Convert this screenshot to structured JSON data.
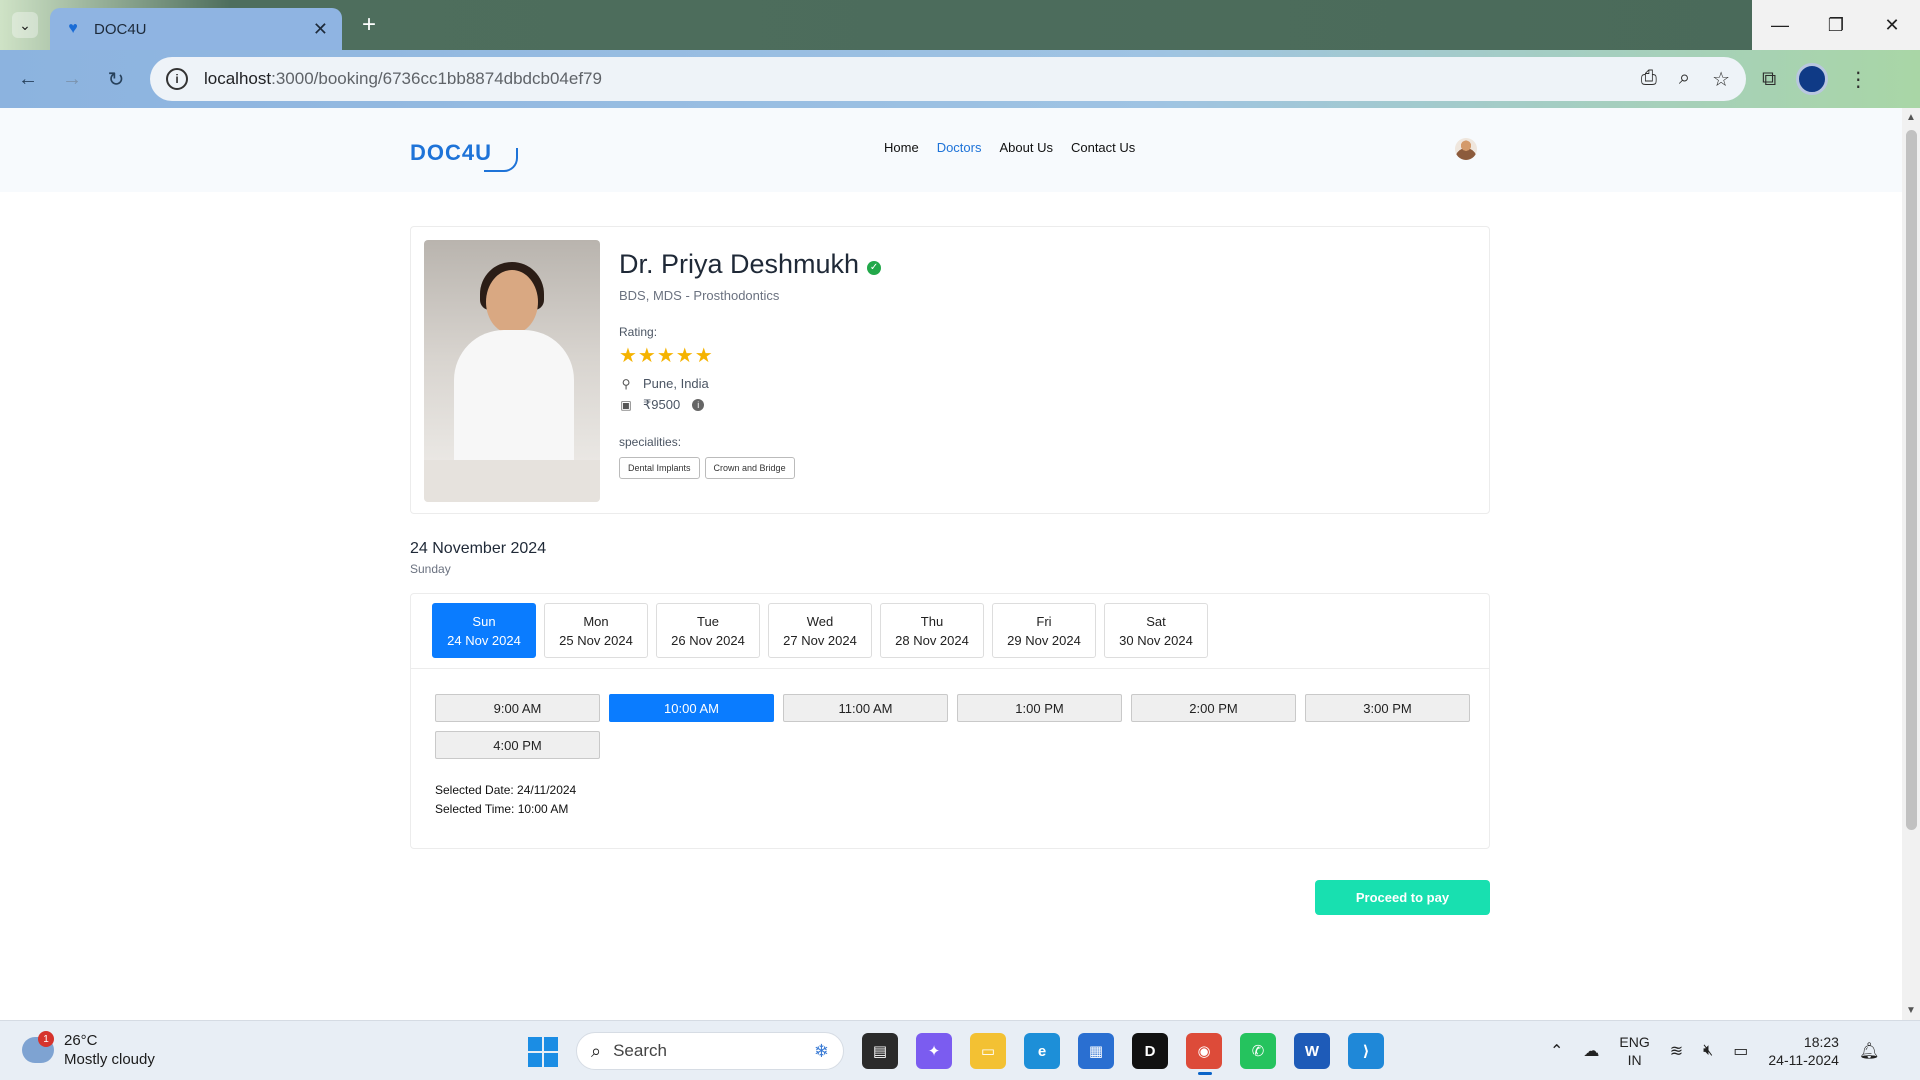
{
  "browser": {
    "tab_title": "DOC4U",
    "url_host": "localhost",
    "url_path": ":3000/booking/6736cc1bb8874dbdcb04ef79"
  },
  "navbar": {
    "logo": "DOC4U",
    "links": [
      "Home",
      "Doctors",
      "About Us",
      "Contact Us"
    ],
    "active_link": "Doctors"
  },
  "doctor": {
    "name": "Dr. Priya Deshmukh",
    "degree": "BDS, MDS - Prosthodontics",
    "rating_label": "Rating:",
    "rating": 5,
    "rating_max": 5,
    "stars": "★★★★★",
    "location": "Pune, India",
    "fee": "₹9500",
    "specialities_label": "specialities:",
    "specialities": [
      "Dental Implants",
      "Crown and Bridge"
    ]
  },
  "booking": {
    "date_title": "24 November 2024",
    "day_sub": "Sunday",
    "days": [
      {
        "day": "Sun",
        "date": "24 Nov 2024",
        "selected": true
      },
      {
        "day": "Mon",
        "date": "25 Nov 2024",
        "selected": false
      },
      {
        "day": "Tue",
        "date": "26 Nov 2024",
        "selected": false
      },
      {
        "day": "Wed",
        "date": "27 Nov 2024",
        "selected": false
      },
      {
        "day": "Thu",
        "date": "28 Nov 2024",
        "selected": false
      },
      {
        "day": "Fri",
        "date": "29 Nov 2024",
        "selected": false
      },
      {
        "day": "Sat",
        "date": "30 Nov 2024",
        "selected": false
      }
    ],
    "times": [
      {
        "label": "9:00 AM",
        "selected": false
      },
      {
        "label": "10:00 AM",
        "selected": true
      },
      {
        "label": "11:00 AM",
        "selected": false
      },
      {
        "label": "1:00 PM",
        "selected": false
      },
      {
        "label": "2:00 PM",
        "selected": false
      },
      {
        "label": "3:00 PM",
        "selected": false
      },
      {
        "label": "4:00 PM",
        "selected": false
      }
    ],
    "selected_date_text": "Selected Date: 24/11/2024",
    "selected_time_text": "Selected Time: 10:00 AM",
    "pay_button": "Proceed to pay"
  },
  "taskbar": {
    "weather_temp": "26°C",
    "weather_desc": "Mostly cloudy",
    "weather_badge": "1",
    "search_label": "Search",
    "lang_line1": "ENG",
    "lang_line2": "IN",
    "time": "18:23",
    "date": "24-11-2024"
  },
  "colors": {
    "primary": "#0a7cff",
    "accent_button": "#18e0b0",
    "star": "#f5b301",
    "verified": "#22a84a"
  }
}
